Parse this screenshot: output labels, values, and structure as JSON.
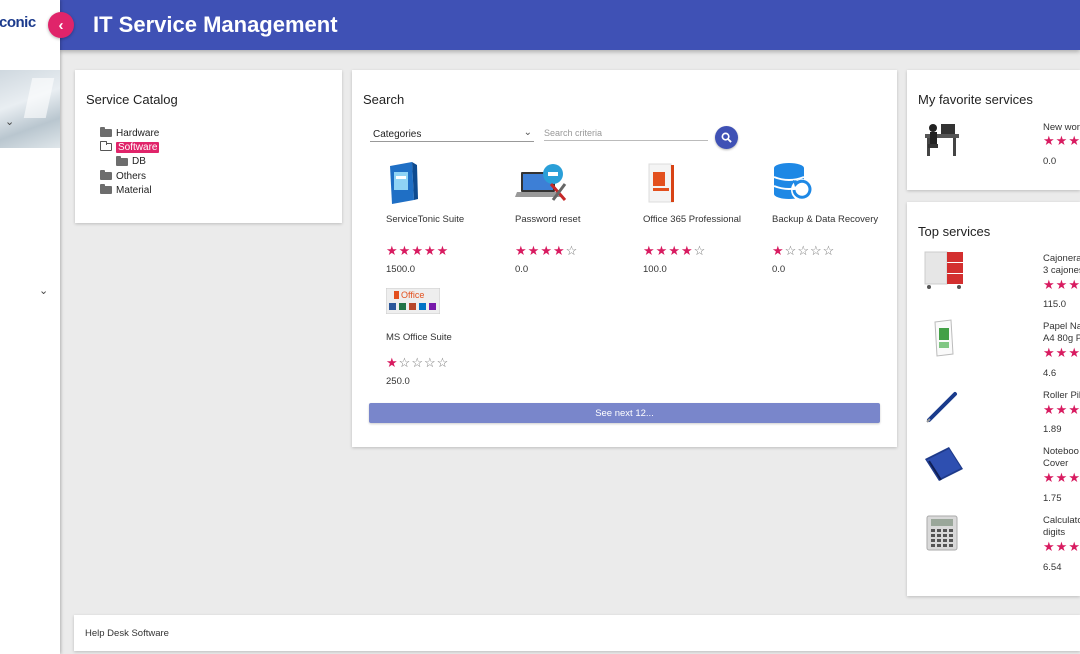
{
  "app": {
    "logo_text": "conic",
    "title": "IT Service Management",
    "collapse_icon": "chevron-left-icon"
  },
  "sidebar": {
    "chevron_icon": "chevron-down-icon"
  },
  "catalog": {
    "title": "Service Catalog",
    "tree": [
      {
        "label": "Hardware",
        "icon": "folder-icon",
        "level": 0
      },
      {
        "label": "Software",
        "icon": "folder-open-icon",
        "level": 0,
        "selected": true
      },
      {
        "label": "DB",
        "icon": "folder-icon",
        "level": 1
      },
      {
        "label": "Others",
        "icon": "folder-icon",
        "level": 0
      },
      {
        "label": "Material",
        "icon": "folder-icon",
        "level": 0
      }
    ]
  },
  "search": {
    "title": "Search",
    "category_select": "Categories",
    "criteria_placeholder": "Search criteria",
    "search_icon": "search-icon",
    "results": [
      {
        "name": "ServiceTonic Suite",
        "rating": 5,
        "price": "1500.0",
        "image": "software-box-image"
      },
      {
        "name": "Password reset",
        "rating": 4,
        "price": "0.0",
        "image": "laptop-tools-image"
      },
      {
        "name": "Office 365 Professional",
        "rating": 4,
        "price": "100.0",
        "image": "office-box-image"
      },
      {
        "name": "Backup & Data Recovery",
        "rating": 1,
        "price": "0.0",
        "image": "database-restore-image"
      },
      {
        "name": "MS Office Suite",
        "rating": 1,
        "price": "250.0",
        "image": "office-suite-banner-image"
      }
    ],
    "next_button": "See next 12..."
  },
  "favorites": {
    "title": "My favorite services",
    "items": [
      {
        "name": "New wor",
        "rating": 3,
        "price": "0.0",
        "image": "workstation-image"
      }
    ]
  },
  "top_services": {
    "title": "Top services",
    "items": [
      {
        "line1": "Cajonera",
        "line2": "3 cajones",
        "price": "115.0",
        "image": "drawer-cabinet-image"
      },
      {
        "line1": "Papel Na",
        "line2": "A4 80g P",
        "price": "4.6",
        "image": "paper-ream-image"
      },
      {
        "line1": "Roller Pil",
        "line2": "",
        "price": "1.89",
        "image": "pen-image"
      },
      {
        "line1": "Noteboo",
        "line2": "Cover",
        "price": "1.75",
        "image": "notebook-image"
      },
      {
        "line1": "Calculato",
        "line2": "digits",
        "price": "6.54",
        "image": "calculator-image"
      }
    ]
  },
  "footer": {
    "text": "Help Desk Software"
  },
  "colors": {
    "header": "#3f51b5",
    "accent": "#e0246a",
    "star": "#d81b60",
    "button": "#7986cb",
    "background": "#ebebeb"
  }
}
